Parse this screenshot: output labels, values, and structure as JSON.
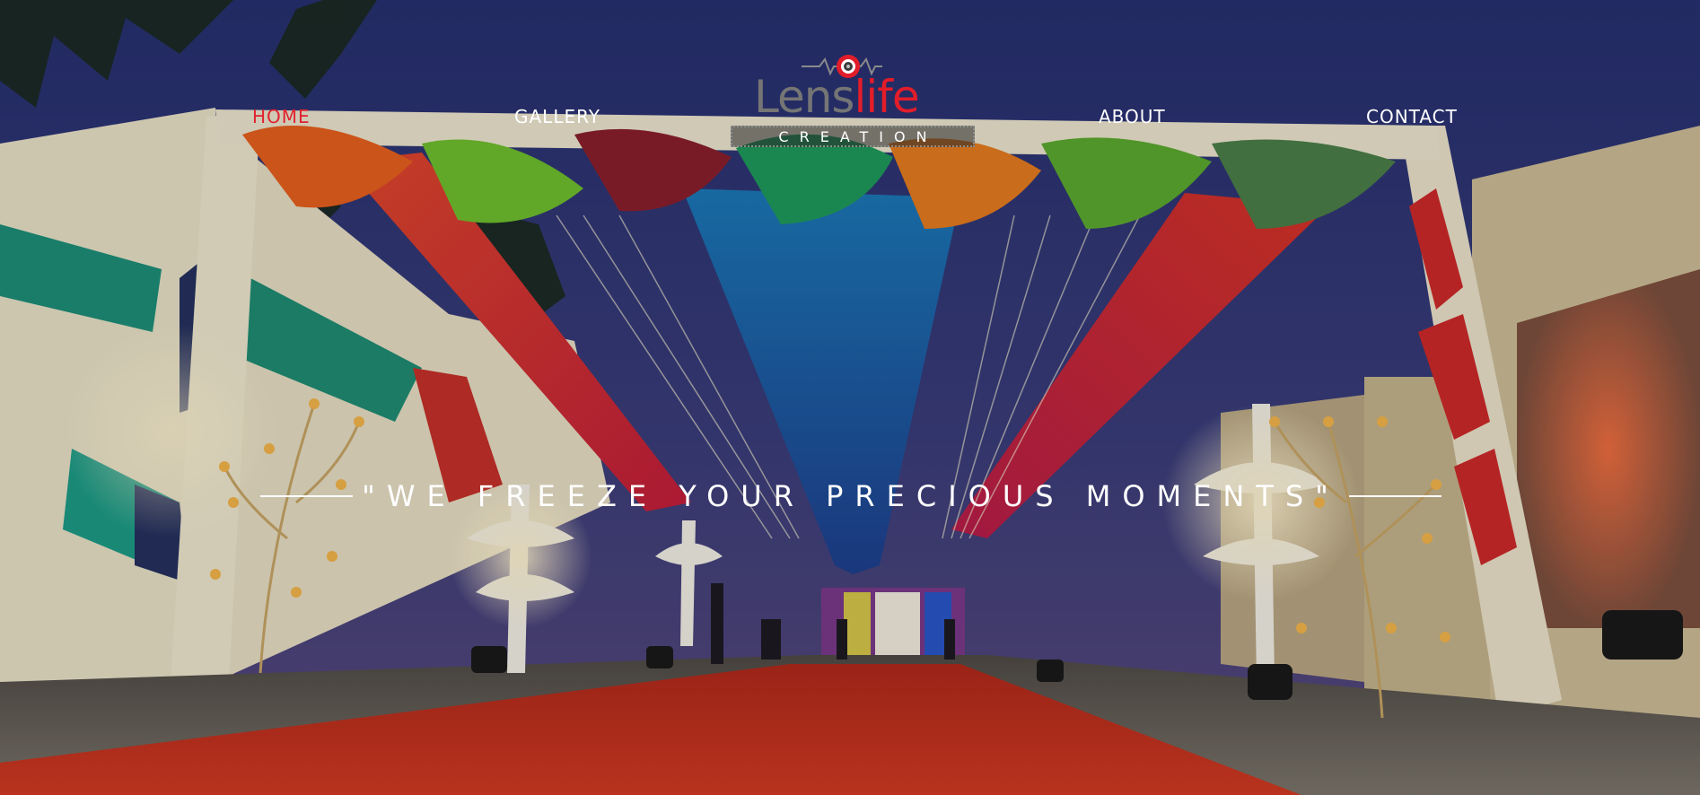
{
  "nav": {
    "items": [
      {
        "label": "HOME",
        "active": true
      },
      {
        "label": "GALLERY",
        "active": false
      },
      {
        "label": "ABOUT",
        "active": false
      },
      {
        "label": "CONTACT",
        "active": false
      }
    ]
  },
  "logo": {
    "word_part1": "Lens",
    "word_part2": "life",
    "subtitle": "CREATION"
  },
  "hero": {
    "tagline": "\"WE FREEZE YOUR PRECIOUS MOMENTS\""
  },
  "colors": {
    "nav_active": "#e0222f",
    "nav_text": "#ffffff",
    "logo_red": "#e21d2a",
    "logo_gray": "#757575",
    "sky": "#2b3266"
  }
}
